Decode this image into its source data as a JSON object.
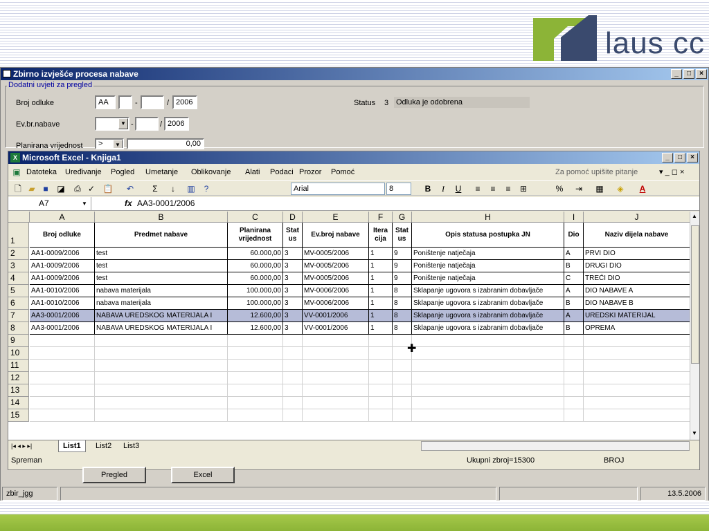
{
  "logo": {
    "text": "laus cc"
  },
  "outer_window": {
    "title": "Zbirno izvješće procesa nabave"
  },
  "conditions": {
    "legend": "Dodatni uvjeti za pregled",
    "broj_odluke_label": "Broj odluke",
    "broj_odluke_prefix": "AA",
    "broj_odluke_year": "2006",
    "evbr_label": "Ev.br.nabave",
    "evbr_year": "2006",
    "planirana_label": "Planirana vrijednost",
    "planirana_op": ">",
    "planirana_value": "0,00",
    "status_label": "Status",
    "status_code": "3",
    "status_text": "Odluka je odobrena"
  },
  "excel": {
    "title": "Microsoft Excel - Knjiga1",
    "menu": [
      "Datoteka",
      "Uređivanje",
      "Pogled",
      "Umetanje",
      "Oblikovanje",
      "Alati",
      "Podaci",
      "Prozor",
      "Pomoć"
    ],
    "help_placeholder": "Za pomoć upišite pitanje",
    "font_name": "Arial",
    "font_size": "8",
    "name_box": "A7",
    "fx": "fx",
    "formula": "AA3-0001/2006",
    "columns": [
      "A",
      "B",
      "C",
      "D",
      "E",
      "F",
      "G",
      "H",
      "I",
      "J"
    ],
    "header_row": [
      "Broj odluke",
      "Predmet nabave",
      "Planirana vrijednost",
      "Stat us",
      "Ev.broj nabave",
      "Itera cija",
      "Stat us",
      "Opis statusa postupka JN",
      "Dio",
      "Naziv dijela nabave"
    ],
    "row_numbers": [
      "1",
      "2",
      "3",
      "4",
      "5",
      "6",
      "7",
      "8",
      "9",
      "10",
      "11",
      "12",
      "13",
      "14",
      "15"
    ],
    "rows": [
      [
        "AA1-0009/2006",
        "test",
        "60.000,00",
        "3",
        "MV-0005/2006",
        "1",
        "9",
        "Poništenje natječaja",
        "A",
        "PRVI DIO"
      ],
      [
        "AA1-0009/2006",
        "test",
        "60.000,00",
        "3",
        "MV-0005/2006",
        "1",
        "9",
        "Poništenje natječaja",
        "B",
        "DRUGI DIO"
      ],
      [
        "AA1-0009/2006",
        "test",
        "60.000,00",
        "3",
        "MV-0005/2006",
        "1",
        "9",
        "Poništenje natječaja",
        "C",
        "TREĆI DIO"
      ],
      [
        "AA1-0010/2006",
        "nabava materijala",
        "100.000,00",
        "3",
        "MV-0006/2006",
        "1",
        "8",
        "Sklapanje ugovora s izabranim dobavljače",
        "A",
        "DIO NABAVE A"
      ],
      [
        "AA1-0010/2006",
        "nabava materijala",
        "100.000,00",
        "3",
        "MV-0006/2006",
        "1",
        "8",
        "Sklapanje ugovora s izabranim dobavljače",
        "B",
        "DIO NABAVE B"
      ],
      [
        "AA3-0001/2006",
        "NABAVA UREDSKOG MATERIJALA I",
        "12.600,00",
        "3",
        "VV-0001/2006",
        "1",
        "8",
        "Sklapanje ugovora s izabranim dobavljače",
        "A",
        "UREDSKI MATERIJAL"
      ],
      [
        "AA3-0001/2006",
        "NABAVA UREDSKOG MATERIJALA I",
        "12.600,00",
        "3",
        "VV-0001/2006",
        "1",
        "8",
        "Sklapanje ugovora s izabranim dobavljače",
        "B",
        "OPREMA"
      ]
    ],
    "sheet_tabs": [
      "List1",
      "List2",
      "List3"
    ],
    "status_ready": "Spreman",
    "status_sum": "Ukupni zbroj=15300",
    "status_mode": "BROJ"
  },
  "buttons": {
    "pregled": "Pregled",
    "excel": "Excel"
  },
  "bottom": {
    "form_name": "zbir_jgg",
    "date": "13.5.2006"
  }
}
